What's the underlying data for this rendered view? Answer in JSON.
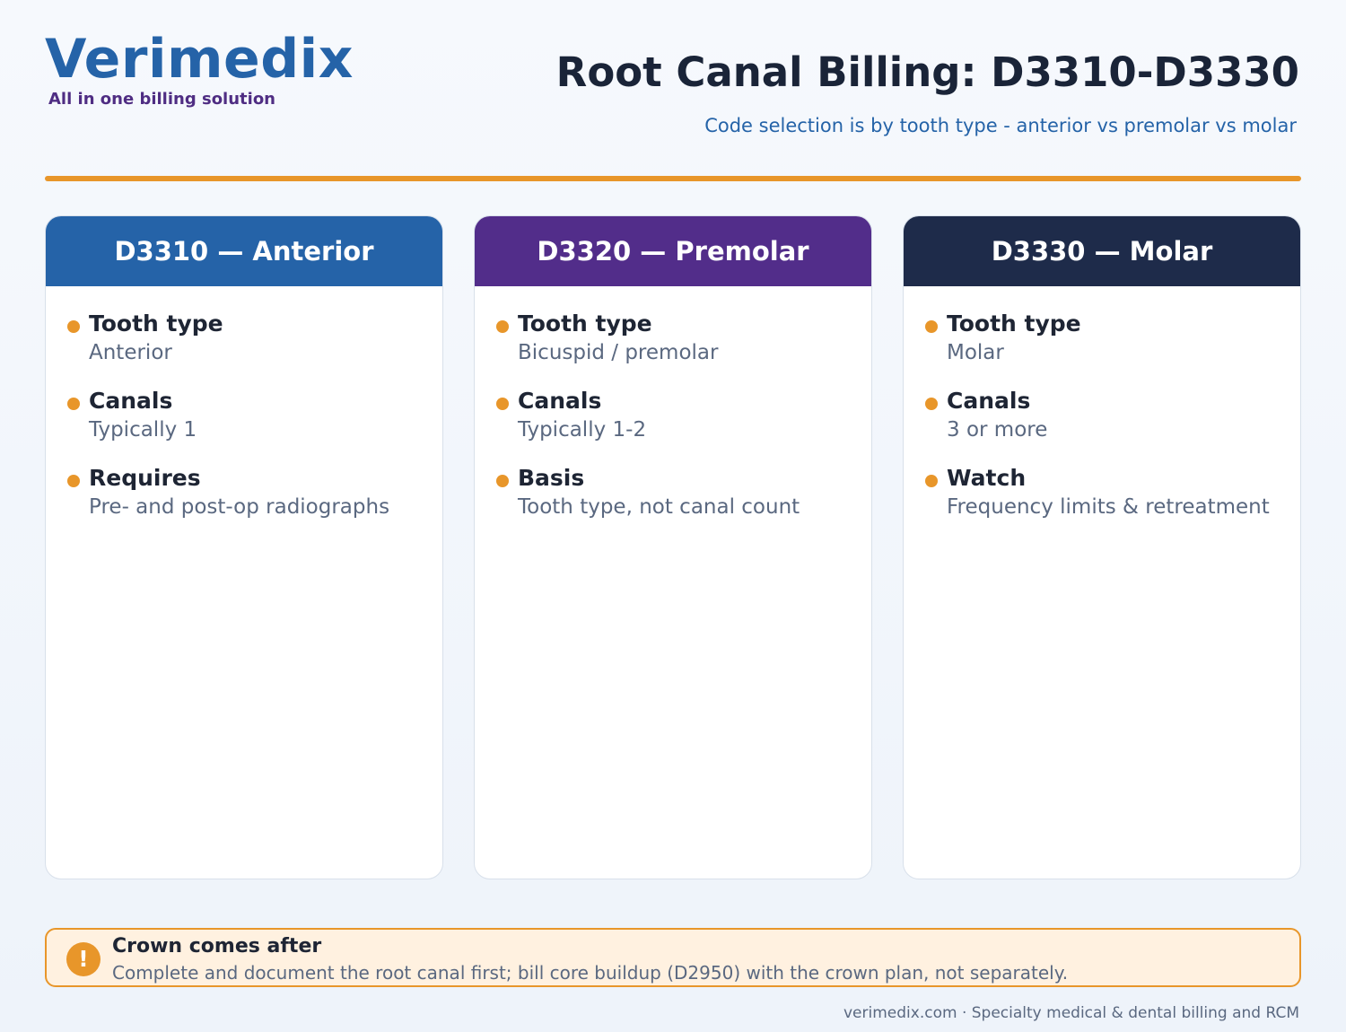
{
  "brand": {
    "name": "Verimedix",
    "tagline": "All in one billing solution"
  },
  "header": {
    "title": "Root Canal Billing: D3310-D3330",
    "subtitle": "Code selection is by tooth type - anterior vs premolar vs molar"
  },
  "colors": {
    "accent": "#e8962a",
    "brand_blue": "#2563a8",
    "brand_purple": "#4f2d83",
    "card1_header": "#2563a8",
    "card2_header": "#522d8a",
    "card3_header": "#1e2b4a",
    "callout_bg": "#fff1e0"
  },
  "cards": [
    {
      "title": "D3310 — Anterior",
      "items": [
        {
          "label": "Tooth type",
          "value": "Anterior"
        },
        {
          "label": "Canals",
          "value": "Typically 1"
        },
        {
          "label": "Requires",
          "value": "Pre- and post-op radiographs"
        }
      ]
    },
    {
      "title": "D3320 — Premolar",
      "items": [
        {
          "label": "Tooth type",
          "value": "Bicuspid / premolar"
        },
        {
          "label": "Canals",
          "value": "Typically 1-2"
        },
        {
          "label": "Basis",
          "value": "Tooth type, not canal count"
        }
      ]
    },
    {
      "title": "D3330 — Molar",
      "items": [
        {
          "label": "Tooth type",
          "value": "Molar"
        },
        {
          "label": "Canals",
          "value": "3 or more"
        },
        {
          "label": "Watch",
          "value": "Frequency limits & retreatment"
        }
      ]
    }
  ],
  "callout": {
    "icon": "exclamation-icon",
    "icon_glyph": "!",
    "title": "Crown comes after",
    "text": "Complete and document the root canal first; bill core buildup (D2950) with the crown plan, not separately."
  },
  "footer": {
    "text": "verimedix.com · Specialty medical & dental billing and RCM"
  }
}
